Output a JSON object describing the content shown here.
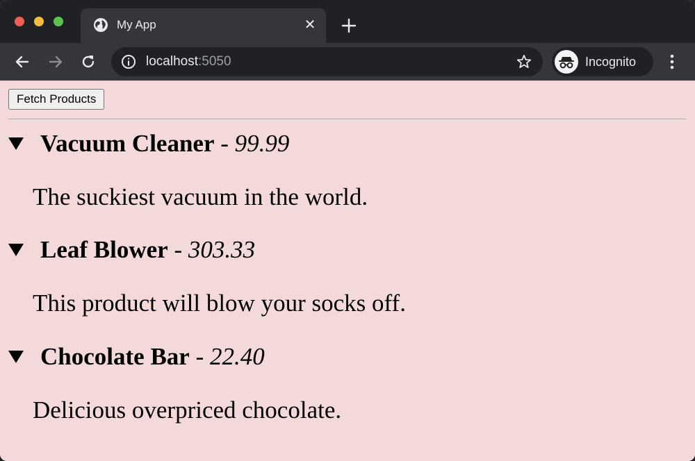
{
  "browser": {
    "tab_title": "My App",
    "new_tab_icon": "plus-icon",
    "url_host": "localhost",
    "url_port": ":5050",
    "profile_label": "Incognito"
  },
  "page": {
    "fetch_button_label": "Fetch Products",
    "separator": " - ",
    "products": [
      {
        "name": "Vacuum Cleaner",
        "price": "99.99",
        "description": "The suckiest vacuum in the world."
      },
      {
        "name": "Leaf Blower",
        "price": "303.33",
        "description": "This product will blow your socks off."
      },
      {
        "name": "Chocolate Bar",
        "price": "22.40",
        "description": "Delicious overpriced chocolate."
      }
    ]
  },
  "colors": {
    "page_background": "#f3d9d9",
    "tabstrip_background": "#1f2124",
    "toolbar_background": "#35363a"
  }
}
